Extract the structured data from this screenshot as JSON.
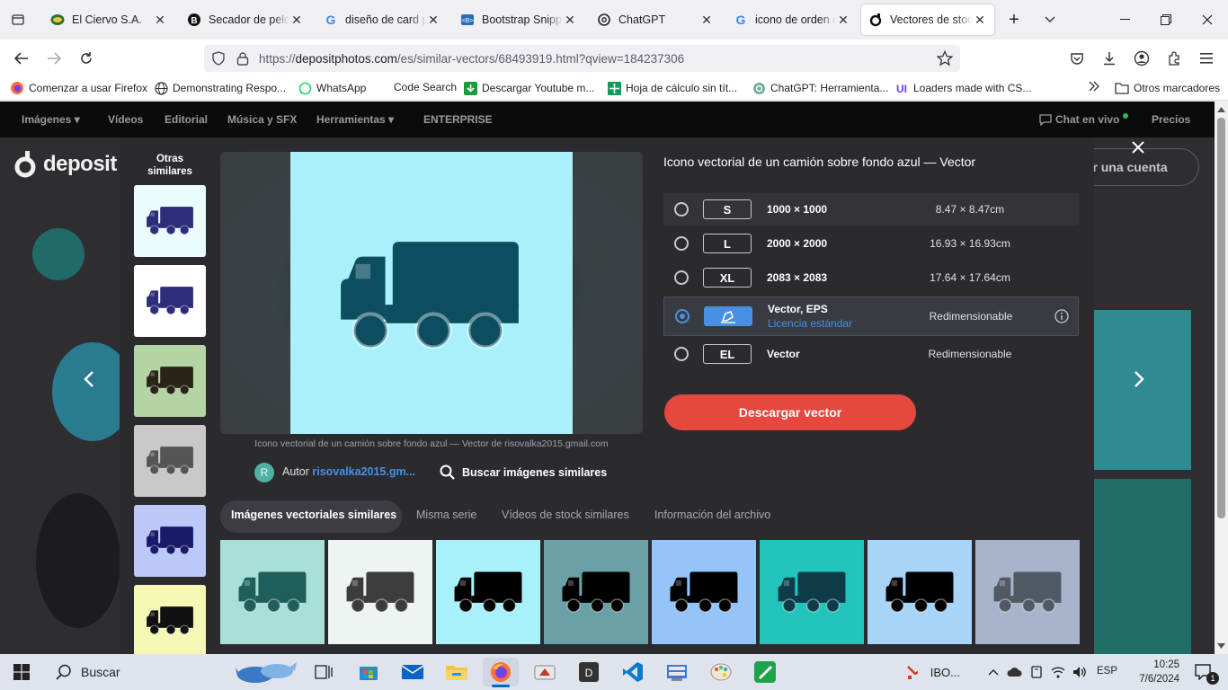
{
  "tabs": [
    {
      "title": "El Ciervo S.A.",
      "icon": "ciervo-logo-icon",
      "active": false
    },
    {
      "title": "Secador de pelo B",
      "icon": "bootstrap-b-icon",
      "active": false
    },
    {
      "title": "diseño de card pe",
      "icon": "google-g-icon",
      "active": false
    },
    {
      "title": "Bootstrap Snippet",
      "icon": "bootstrap-snippets-icon",
      "active": false
    },
    {
      "title": "ChatGPT",
      "icon": "openai-icon",
      "active": false
    },
    {
      "title": "icono de orden de",
      "icon": "google-g-icon",
      "active": false
    },
    {
      "title": "Vectores de stock",
      "icon": "depositphotos-icon",
      "active": true
    }
  ],
  "address": {
    "prefix": "https://",
    "host": "depositphotos.com",
    "path": "/es/similar-vectors/68493919.html?qview=184237306"
  },
  "bookmarks": [
    {
      "label": "Comenzar a usar Firefox",
      "icon": "firefox-icon"
    },
    {
      "label": "Demonstrating Respo...",
      "icon": "globe-icon"
    },
    {
      "label": "WhatsApp",
      "icon": "whatsapp-icon"
    },
    {
      "label": "Code Search",
      "icon": "none"
    },
    {
      "label": "Descargar Youtube m...",
      "icon": "download-green-icon"
    },
    {
      "label": "Hoja de cálculo sin tít...",
      "icon": "sheets-icon"
    },
    {
      "label": "ChatGPT: Herramienta...",
      "icon": "chatgpt-icon"
    },
    {
      "label": "Loaders made with CS...",
      "icon": "ui-icon"
    }
  ],
  "bookmarks_more": "Otros marcadores",
  "site_nav": {
    "items": [
      "Imágenes",
      "Vídeos",
      "Editorial",
      "Música y SFX",
      "Herramientas",
      "ENTERPRISE"
    ],
    "chat": "Chat en vivo",
    "pricing": "Precios",
    "logo": "deposit",
    "create_account": "r una cuenta"
  },
  "modal": {
    "others_title": "Otras similares",
    "thumb_colors": [
      "#eafcfc",
      "#ffffff",
      "#b4d4a4",
      "#c8c8c8",
      "#bcc8f8",
      "#f4f8b4"
    ],
    "thumb_truck_colors": [
      "#2d2d7a",
      "#2d2d7a",
      "#2a2418",
      "#555555",
      "#1a1a6a",
      "#111111"
    ],
    "preview_bg": "#aaf0fa",
    "truck_color": "#0c4e60",
    "caption": "Icono vectorial de un camión sobre fondo azul — Vector de risovalka2015.gmail.com",
    "author_initial": "R",
    "author_label": "Autor",
    "author_name": "risovalka2015.gm...",
    "search_similar": "Buscar imágenes similares",
    "title": "Icono vectorial de un camión sobre fondo azul — Vector",
    "sizes": [
      {
        "badge": "S",
        "dims": "1000 × 1000",
        "cm": "8.47 × 8.47cm",
        "selected": false
      },
      {
        "badge": "L",
        "dims": "2000 × 2000",
        "cm": "16.93 × 16.93cm",
        "selected": false
      },
      {
        "badge": "XL",
        "dims": "2083 × 2083",
        "cm": "17.64 × 17.64cm",
        "selected": false
      },
      {
        "badge": "",
        "dims": "Vector, EPS",
        "license": "Licencia estándar",
        "cm": "Redimensionable",
        "selected": true
      },
      {
        "badge": "EL",
        "dims": "Vector",
        "cm": "Redimensionable",
        "selected": false
      }
    ],
    "download_label": "Descargar vector",
    "tabs": [
      "Imágenes vectoriales similares",
      "Misma serie",
      "Vídeos de stock similares",
      "Información del archivo"
    ],
    "grid_colors": [
      "#a8e0d8",
      "#eef4f2",
      "#a8f0fa",
      "#6aa0a8",
      "#94c4f8",
      "#22c4bc",
      "#a8d4f8",
      "#a8b4cc"
    ],
    "grid_truck_colors": [
      "#1f5e5a",
      "#3c3c3c",
      "#000000",
      "#000000",
      "#000000",
      "#0d3c48",
      "#000000",
      "#505a64"
    ]
  },
  "taskbar": {
    "search_placeholder": "Buscar",
    "tray_app": "IBO...",
    "lang": "ESP",
    "time": "10:25",
    "date": "7/6/2024",
    "notifications": "1"
  },
  "colors": {
    "accent": "#4a90e2",
    "download": "#e4483f",
    "link": "#4a90e2"
  }
}
